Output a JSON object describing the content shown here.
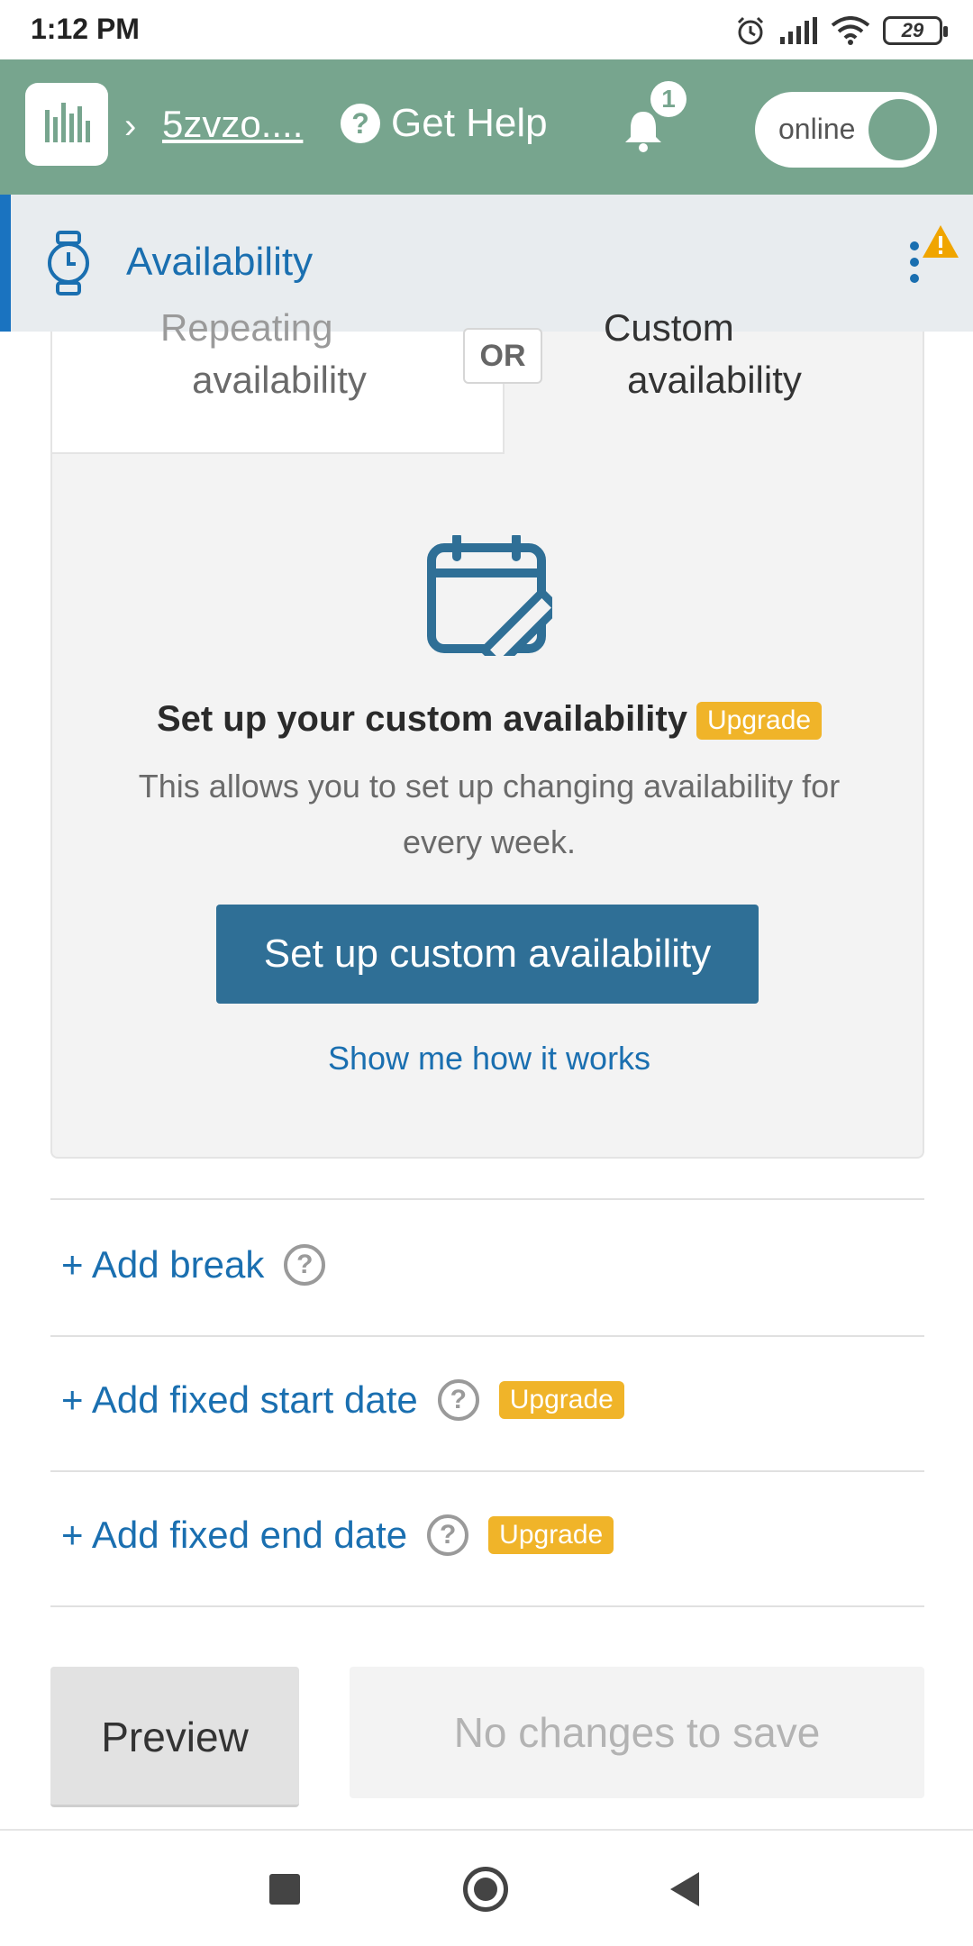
{
  "status_bar": {
    "time": "1:12 PM",
    "battery": "29"
  },
  "header": {
    "workspace": "5zvzo....",
    "help_label": "Get Help",
    "notifications_count": "1",
    "status_toggle": "online",
    "brand_color": "#77a58e"
  },
  "section": {
    "title": "Availability"
  },
  "choice": {
    "left_partial": "Repeating",
    "left_label": "availability",
    "or_label": "OR",
    "right_partial": "Custom",
    "right_label": "availability"
  },
  "card": {
    "headline": "Set up your custom availability",
    "upgrade_badge": "Upgrade",
    "description": "This allows you to set up changing availability for every week.",
    "primary_button": "Set up custom availability",
    "help_link": "Show me how it works"
  },
  "options": {
    "add_break": "+ Add break",
    "add_start": "+ Add fixed start date",
    "add_end": "+ Add fixed end date",
    "upgrade_badge": "Upgrade"
  },
  "footer": {
    "preview_button": "Preview",
    "save_button": "No changes to save"
  },
  "colors": {
    "accent_blue": "#1a6fb0",
    "primary_button": "#2f6f96",
    "upgrade": "#f0b429"
  }
}
